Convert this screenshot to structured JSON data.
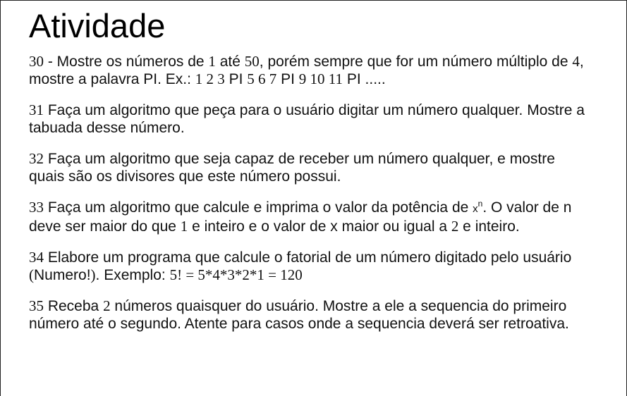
{
  "title": "Atividade",
  "exercises": [
    {
      "number": "30",
      "parts": [
        " - Mostre os números de ",
        "1",
        " até ",
        "50",
        ", porém sempre que for um número múltiplo de ",
        "4",
        ", mostre a palavra PI. Ex.: ",
        "1 2 3",
        " PI ",
        "5 6 7",
        " PI ",
        "9 10 11",
        " PI ....."
      ]
    },
    {
      "number": "31",
      "text": " Faça um algoritmo que peça para o usuário digitar um número qualquer. Mostre a tabuada desse número."
    },
    {
      "number": "32",
      "text": " Faça um algoritmo que seja capaz de receber um número qualquer, e mostre quais são os divisores que este número possui."
    },
    {
      "number": "33",
      "parts": [
        " Faça um algoritmo que calcule e imprima o valor da potência de ",
        "x",
        "n",
        ". O valor de n deve ser maior do que ",
        "1",
        " e inteiro e o valor de x maior ou igual a ",
        "2",
        " e inteiro."
      ]
    },
    {
      "number": "34",
      "parts": [
        " Elabore um programa que calcule o fatorial de um número digitado pelo usuário ",
        "(",
        "Numero!",
        ")",
        ". Exemplo: ",
        "5! = 5*4*3*2*1 = 120"
      ]
    },
    {
      "number": "35",
      "parts": [
        " Receba ",
        "2",
        " números quaisquer do usuário. Mostre a ele a sequencia do primeiro número até o segundo. Atente para casos onde a sequencia deverá ser retroativa."
      ]
    }
  ]
}
